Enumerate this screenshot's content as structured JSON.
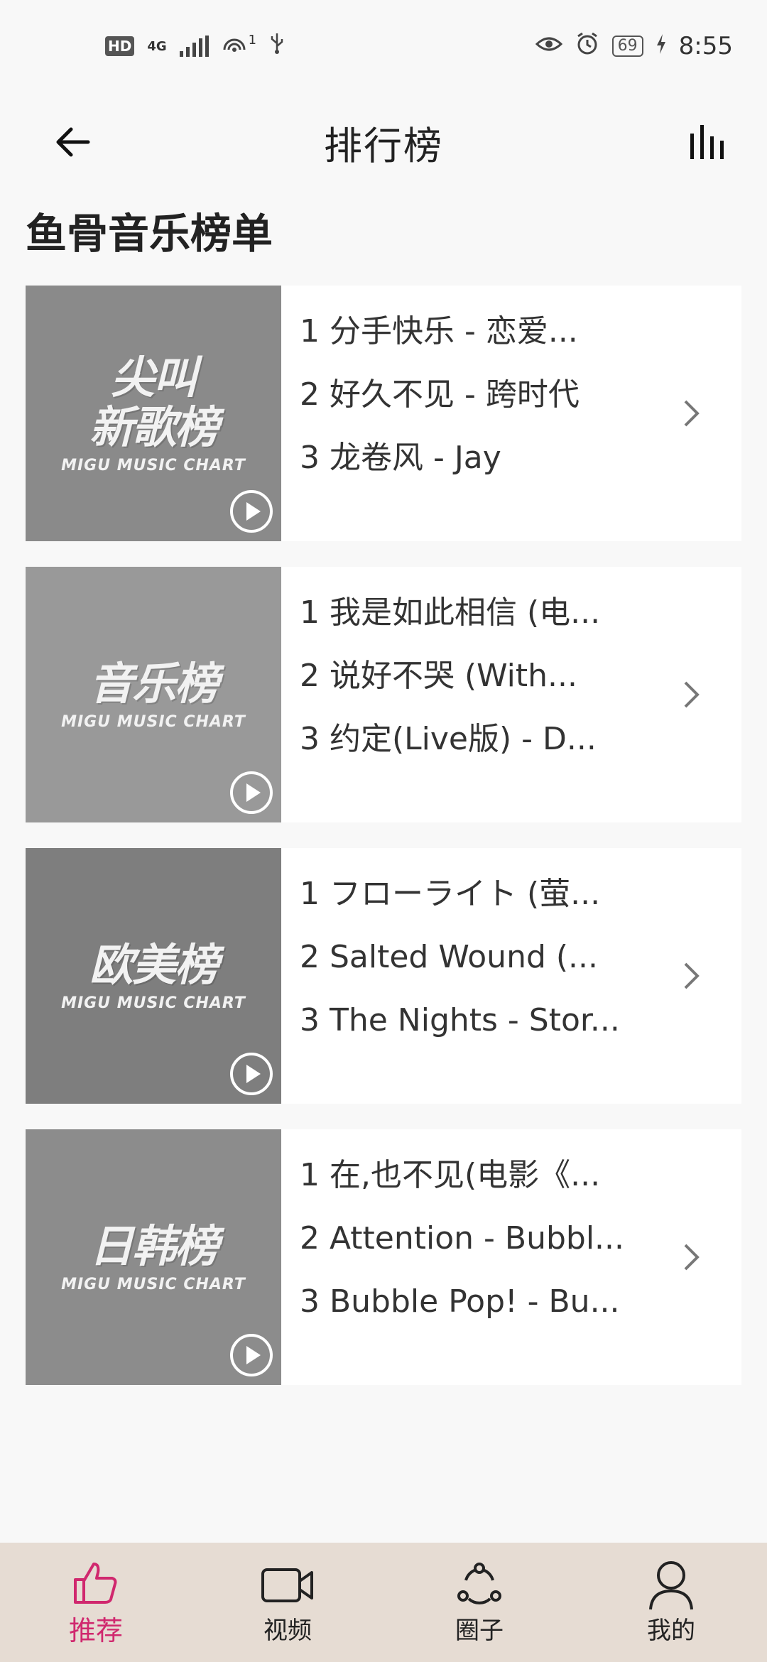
{
  "status_bar": {
    "hd": "HD",
    "network": "4G",
    "hotspot_count": "1",
    "battery": "69",
    "time": "8:55"
  },
  "header": {
    "title": "排行榜"
  },
  "section_title": "鱼骨音乐榜单",
  "charts": [
    {
      "cover_title_line1": "尖叫",
      "cover_title_line2": "新歌榜",
      "cover_subtitle": "MIGU MUSIC CHART",
      "cover_color": "#8a8a8a",
      "tracks": [
        "1 分手快乐 - 恋爱...",
        "2 好久不见 - 跨时代",
        "3 龙卷风 - Jay"
      ]
    },
    {
      "cover_title_line1": "",
      "cover_title_line2": "音乐榜",
      "cover_subtitle": "MIGU MUSIC CHART",
      "cover_color": "#999999",
      "tracks": [
        "1 我是如此相信 (电...",
        "2 说好不哭 (With...",
        "3 约定(Live版) - D..."
      ]
    },
    {
      "cover_title_line1": "",
      "cover_title_line2": "欧美榜",
      "cover_subtitle": "MIGU MUSIC CHART",
      "cover_color": "#7e7e7e",
      "tracks": [
        "1 フローライト (萤...",
        "2 Salted Wound (...",
        "3 The Nights - Stor..."
      ]
    },
    {
      "cover_title_line1": "",
      "cover_title_line2": "日韩榜",
      "cover_subtitle": "MIGU MUSIC CHART",
      "cover_color": "#8c8c8c",
      "tracks": [
        "1 在,也不见(电影《...",
        "2 Attention - Bubbl...",
        "3 Bubble Pop! - Bu..."
      ]
    }
  ],
  "bottom_nav": [
    {
      "label": "推荐",
      "icon": "thumbs-up-icon",
      "active": true
    },
    {
      "label": "视频",
      "icon": "video-camera-icon",
      "active": false
    },
    {
      "label": "圈子",
      "icon": "circle-share-icon",
      "active": false
    },
    {
      "label": "我的",
      "icon": "person-icon",
      "active": false
    }
  ],
  "colors": {
    "accent": "#d0286e",
    "nav_bg": "#e6dcd3",
    "page_bg": "#f8f8f8"
  }
}
